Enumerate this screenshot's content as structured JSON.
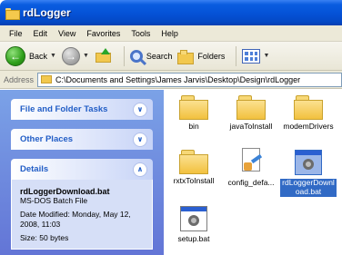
{
  "window": {
    "title": "rdLogger"
  },
  "menu": [
    "File",
    "Edit",
    "View",
    "Favorites",
    "Tools",
    "Help"
  ],
  "toolbar": {
    "back_label": "Back",
    "search_label": "Search",
    "folders_label": "Folders"
  },
  "address": {
    "label": "Address",
    "path": "C:\\Documents and Settings\\James Jarvis\\Desktop\\Design\\rdLogger"
  },
  "taskpane": {
    "file_folder_tasks": "File and Folder Tasks",
    "other_places": "Other Places",
    "details": {
      "title": "Details",
      "name": "rdLoggerDownload.bat",
      "type": "MS-DOS Batch File",
      "date_modified": "Date Modified: Monday, May 12, 2008, 11:03",
      "size": "Size: 50 bytes"
    }
  },
  "files": [
    {
      "name": "bin",
      "kind": "folder"
    },
    {
      "name": "javaToInstall",
      "kind": "folder"
    },
    {
      "name": "modemDrivers",
      "kind": "folder"
    },
    {
      "name": "rxtxToInstall",
      "kind": "folder"
    },
    {
      "name": "config_defa...",
      "kind": "config"
    },
    {
      "name": "rdLoggerDownload.bat",
      "kind": "batch",
      "selected": true
    },
    {
      "name": "setup.bat",
      "kind": "batch"
    }
  ],
  "colors": {
    "titlebar": "#0553d8",
    "taskpane_bg": "#7ba2e7",
    "panel_title": "#215dc6",
    "selection": "#316ac5"
  }
}
